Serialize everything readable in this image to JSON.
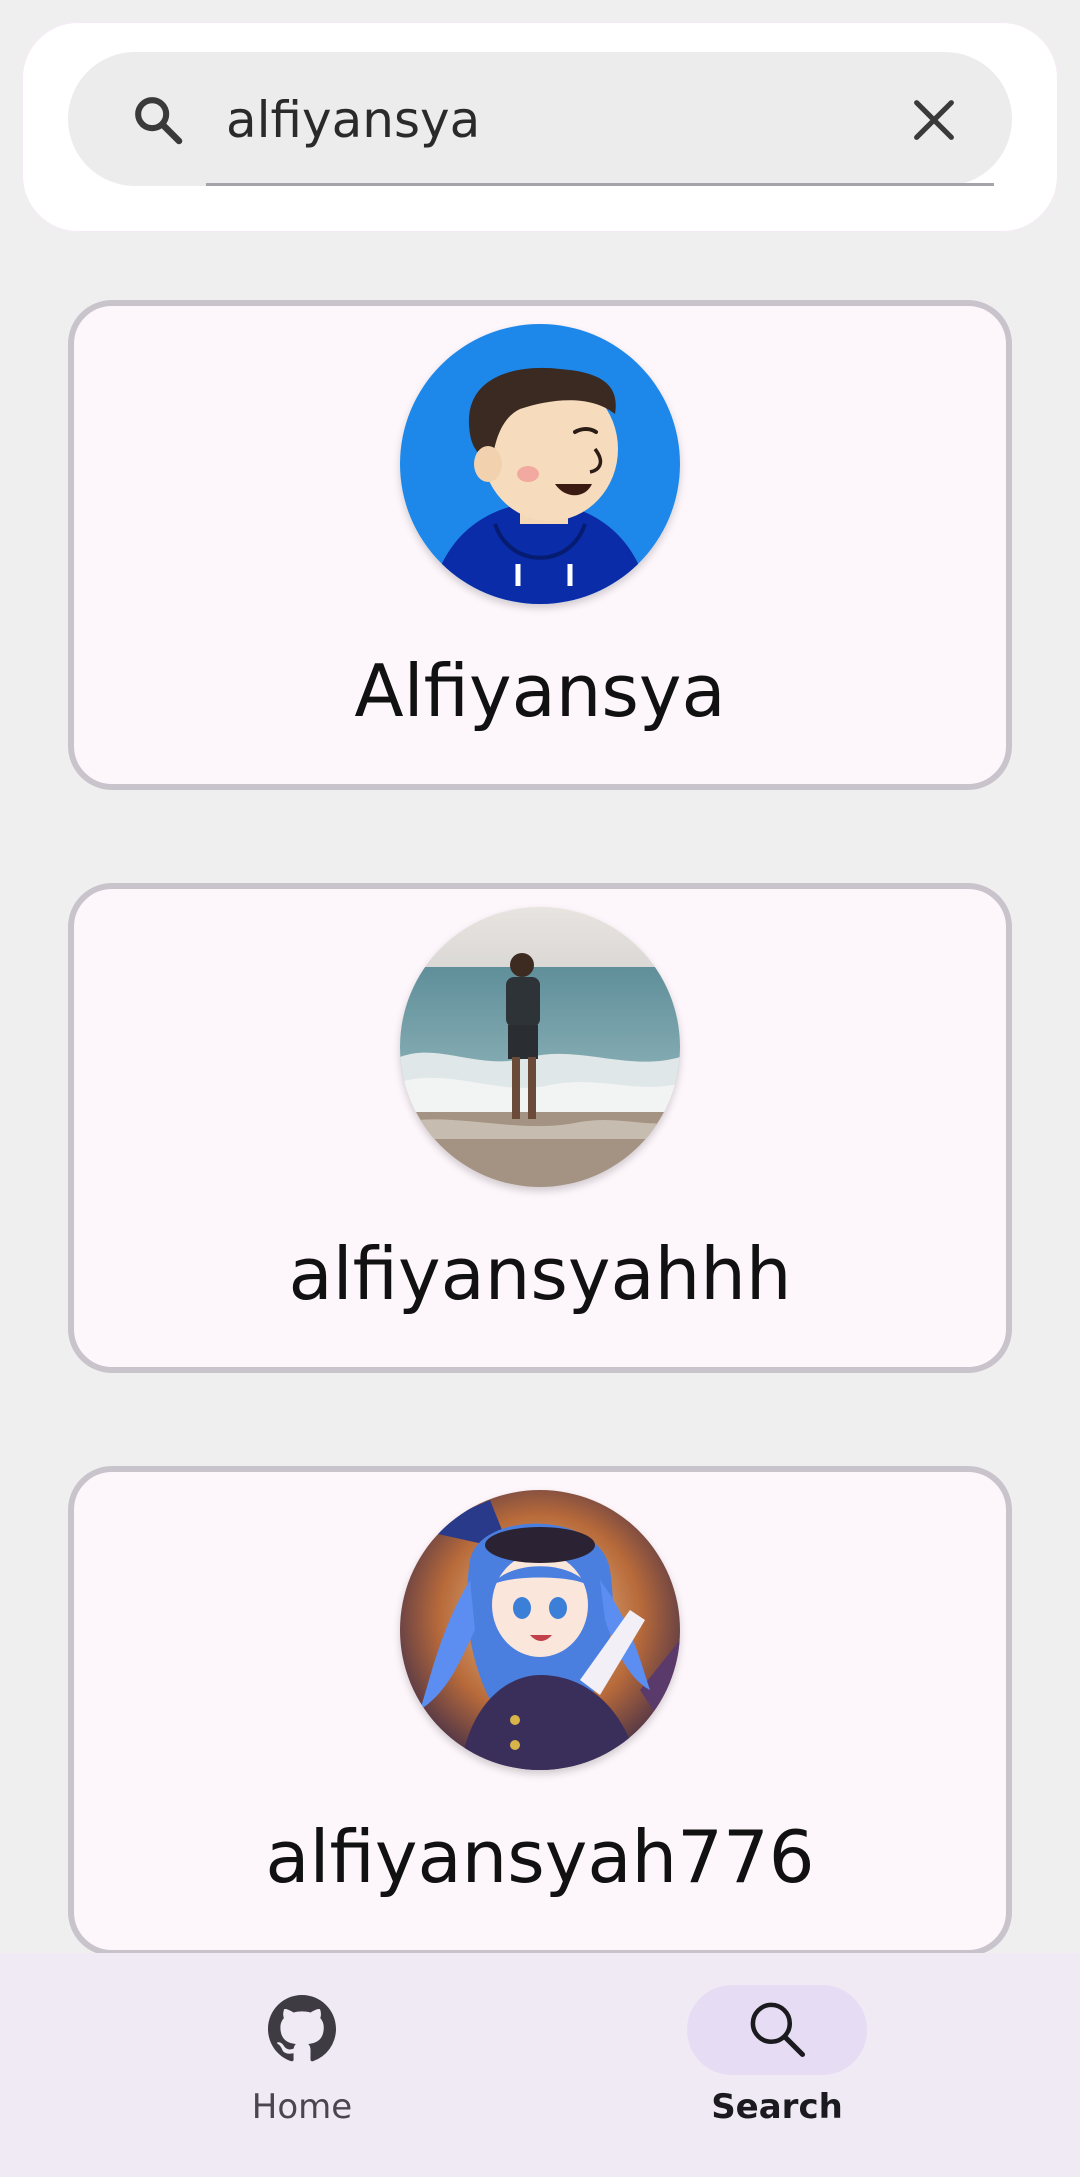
{
  "search": {
    "query": "alfiyansya",
    "icon": "search-icon",
    "clear_icon": "close-icon"
  },
  "results": [
    {
      "username": "Alfiyansya",
      "avatar": "cartoon-avatar"
    },
    {
      "username": "alfiyansyahhh",
      "avatar": "beach-photo-avatar"
    },
    {
      "username": "alfiyansyah776",
      "avatar": "anime-avatar"
    }
  ],
  "nav": {
    "home_label": "Home",
    "home_icon": "github-icon",
    "search_label": "Search",
    "search_icon": "search-icon",
    "active": "Search"
  },
  "colors": {
    "background": "#efefef",
    "card_background": "#fdf6fb",
    "card_border": "#c9c3cc",
    "nav_background": "#f0eaf4",
    "nav_active_pill": "#e6dcf4"
  }
}
